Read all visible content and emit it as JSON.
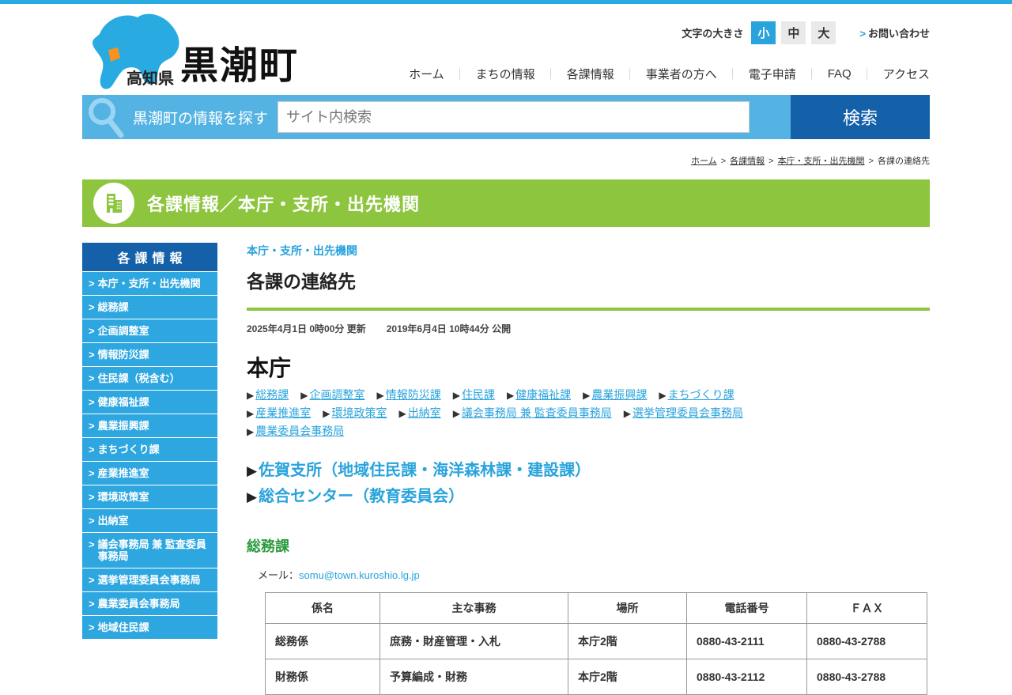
{
  "colors": {
    "accent_cyan": "#2EA7E0",
    "dark_blue": "#1561A9",
    "banner_green": "#8DC53F",
    "heading_green": "#2B9A3E",
    "link_blue": "#29A3DC",
    "map_orange": "#F7931E"
  },
  "icons": {
    "chevron": ">",
    "triangle": "▶",
    "nav_separator": "｜",
    "breadcrumb_separator": ">"
  },
  "header": {
    "logo": {
      "prefecture": "高知県",
      "town": "黒潮町"
    },
    "font_size": {
      "label": "文字の大きさ",
      "options": [
        "小",
        "中",
        "大"
      ],
      "active": "小"
    },
    "contact_label": "お問い合わせ",
    "nav": [
      "ホーム",
      "まちの情報",
      "各課情報",
      "事業者の方へ",
      "電子申請",
      "FAQ",
      "アクセス"
    ]
  },
  "search": {
    "label": "黒潮町の情報を探す",
    "placeholder": "サイト内検索",
    "button": "検索"
  },
  "breadcrumb": [
    {
      "label": "ホーム",
      "link": true
    },
    {
      "label": "各課情報",
      "link": true
    },
    {
      "label": "本庁・支所・出先機関",
      "link": true
    },
    {
      "label": "各課の連絡先",
      "link": false
    }
  ],
  "banner": {
    "title": "各課情報／本庁・支所・出先機関"
  },
  "sidebar": {
    "title": "各課情報",
    "items": [
      "本庁・支所・出先機関",
      "総務課",
      "企画調整室",
      "情報防災課",
      "住民課（税含む）",
      "健康福祉課",
      "農業振興課",
      "まちづくり課",
      "産業推進室",
      "環境政策室",
      "出納室",
      "議会事務局 兼 監査委員事務局",
      "選挙管理委員会事務局",
      "農業委員会事務局",
      "地域住民課"
    ]
  },
  "main": {
    "category_link": "本庁・支所・出先機関",
    "title": "各課の連絡先",
    "updated": "2025年4月1日 0時00分 更新",
    "published": "2019年6月4日 10時44分 公開",
    "honcho": {
      "title": "本庁",
      "link_lines": [
        [
          "総務課",
          "企画調整室",
          "情報防災課",
          "住民課",
          "健康福祉課",
          "農業振興課",
          "まちづくり課"
        ],
        [
          "産業推進室",
          "環境政策室",
          "出納室",
          "議会事務局 兼 監査委員事務局",
          "選挙管理委員会事務局"
        ],
        [
          "農業委員会事務局"
        ]
      ]
    },
    "branch_links": [
      "佐賀支所（地域住民課・海洋森林課・建設課）",
      "総合センター（教育委員会）"
    ],
    "soumu": {
      "title": "総務課",
      "mail_label": "メール：",
      "mail": "somu@town.kuroshio.lg.jp"
    },
    "table": {
      "headers": [
        "係名",
        "主な事務",
        "場所",
        "電話番号",
        "ＦＡＸ"
      ],
      "rows": [
        [
          "総務係",
          "庶務・財産管理・入札",
          "本庁2階",
          "0880-43-2111",
          "0880-43-2788"
        ],
        [
          "財務係",
          "予算編成・財務",
          "本庁2階",
          "0880-43-2112",
          "0880-43-2788"
        ]
      ]
    }
  }
}
